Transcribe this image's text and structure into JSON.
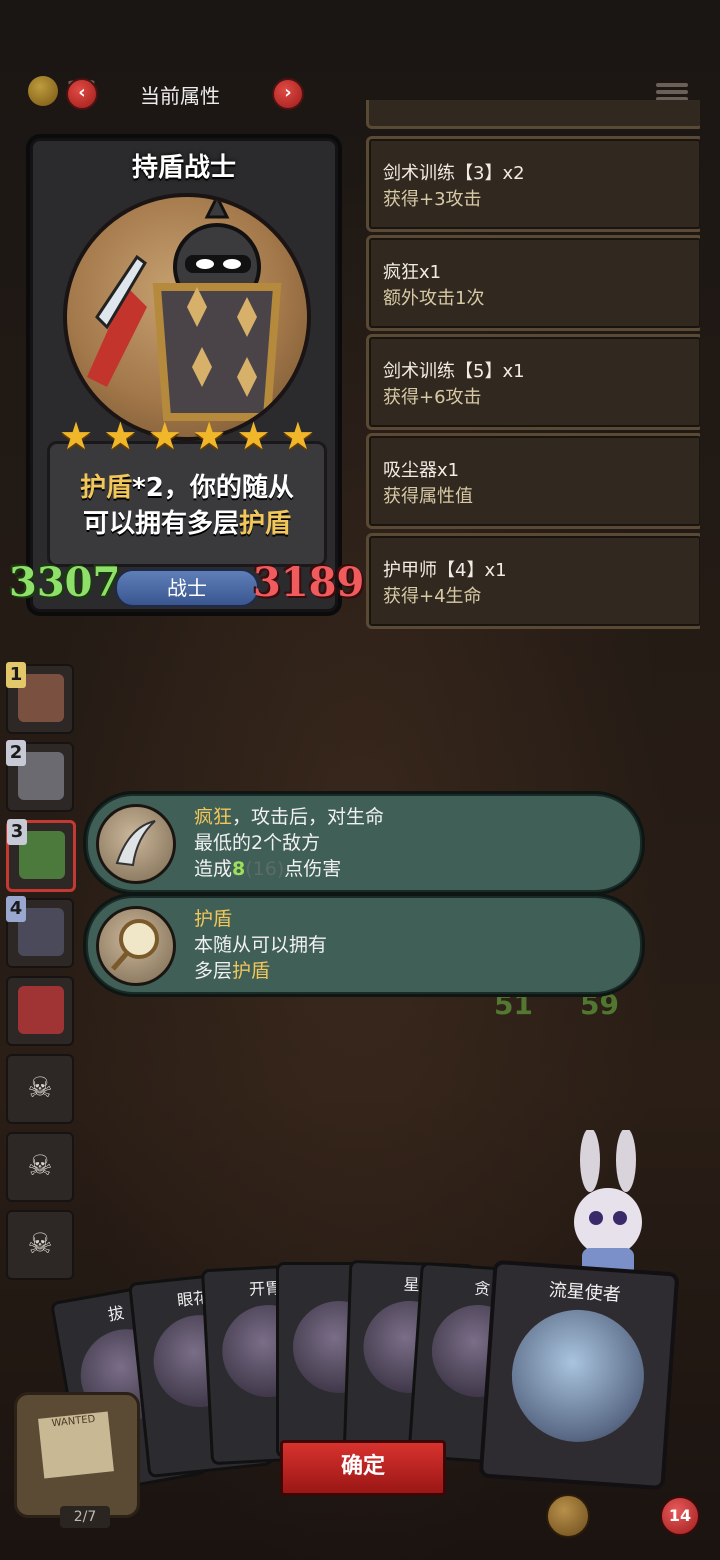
{
  "topbar": {
    "coin_count": "16",
    "title": "当前属性",
    "prev_label": "‹",
    "next_label": "›"
  },
  "hero": {
    "name": "持盾战士",
    "stars": 6,
    "star_glyph": "★",
    "desc_part1": "护盾",
    "desc_part2": "*2，你的随从",
    "desc_part3": "可以拥有多层",
    "desc_part4": "护盾",
    "attack": "3307",
    "hp": "3189",
    "class": "战士"
  },
  "bonuses": [
    {
      "title": "剑术训练【3】x2",
      "effect": "获得+3攻击"
    },
    {
      "title": "疯狂x1",
      "effect": "额外攻击1次"
    },
    {
      "title": "剑术训练【5】x1",
      "effect": "获得+6攻击"
    },
    {
      "title": "吸尘器x1",
      "effect": "获得属性值"
    },
    {
      "title": "护甲师【4】x1",
      "effect": "获得+4生命"
    }
  ],
  "team": {
    "slot_numbers": [
      "1",
      "2",
      "3",
      "4"
    ],
    "skull_glyph": "☠"
  },
  "skills": [
    {
      "name": "疯狂",
      "line1_rest": "，攻击后，对生命",
      "line2": "最低的2个敌方",
      "line3_a": "造成",
      "line3_value": "8",
      "line3_dim": "(16)",
      "line3_b": "点伤害"
    },
    {
      "name": "护盾",
      "line2": "本随从可以拥有",
      "line3_a": "多层",
      "line3_hl": "护盾"
    }
  ],
  "shop": {
    "cards": [
      "拔",
      "眼花",
      "开胃",
      "",
      "星",
      "贪"
    ],
    "front_card_name": "流星使者",
    "confirm_label": "确定",
    "wanted_label": "WANTED",
    "counter": "2/7",
    "lives": "14"
  },
  "background_stats": {
    "left": "51",
    "right": "59"
  },
  "colors": {
    "accent_gold": "#f1c65a",
    "attack_green": "#8fe06a",
    "hp_red": "#f05b5e",
    "confirm_red": "#d8322e",
    "skill_bg": "#3f5f57"
  }
}
